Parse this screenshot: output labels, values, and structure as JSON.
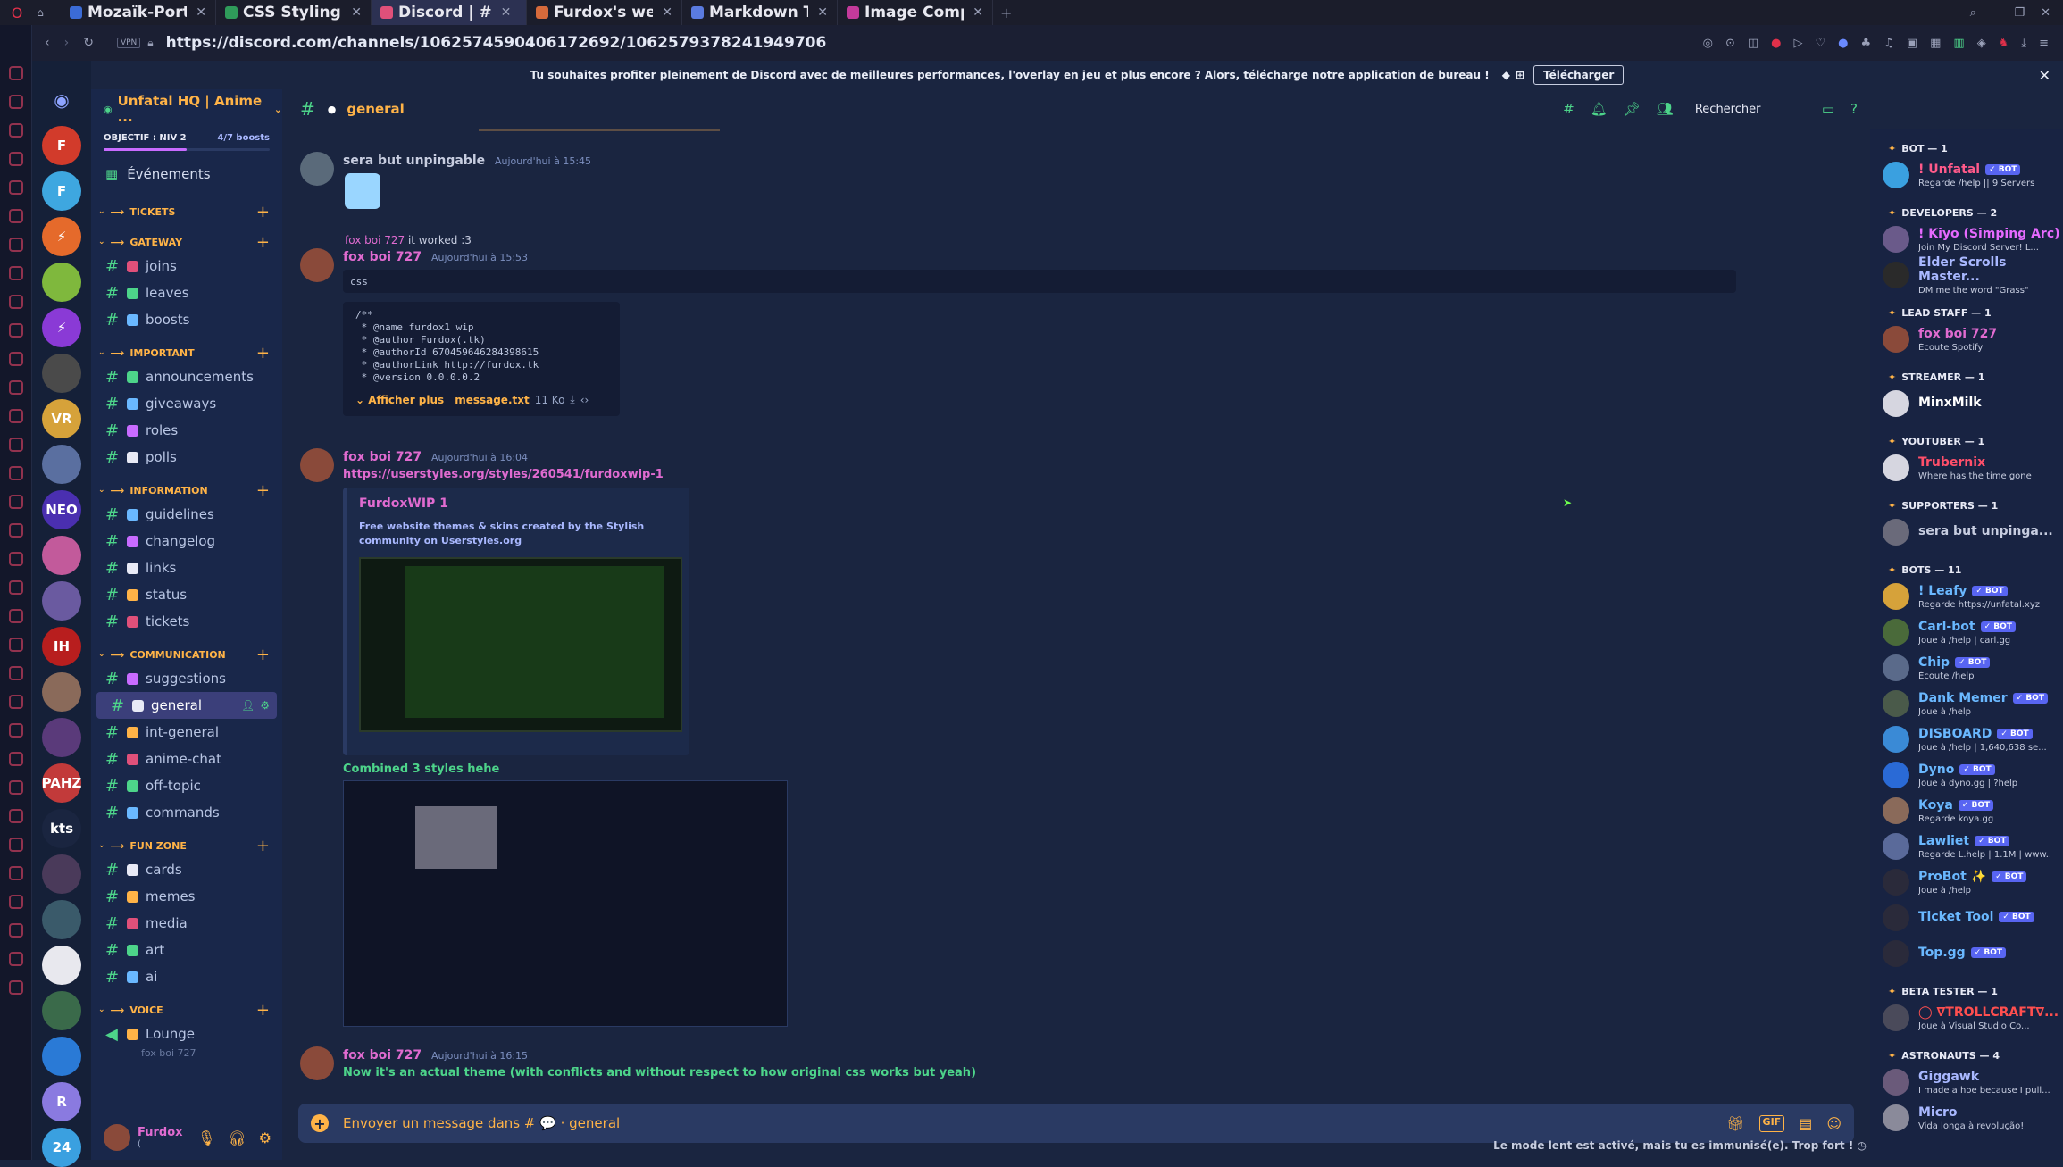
{
  "browser": {
    "tabs": [
      {
        "label": "Mozaïk-Portail",
        "color": "#3b6bd6"
      },
      {
        "label": "CSS Styling Ima",
        "color": "#2f9b5a"
      },
      {
        "label": "Discord | #",
        "color": "#e0507a"
      },
      {
        "label": "Furdox's websi",
        "color": "#d66a3b"
      },
      {
        "label": "Markdown Tex",
        "color": "#5a7be0"
      },
      {
        "label": "Image Compre",
        "color": "#c33a9b"
      }
    ],
    "url": "https://discord.com/channels/1062574590406172692/1062579378241949706"
  },
  "banner": {
    "text": "Tu souhaites profiter pleinement de Discord avec de meilleures performances, l'overlay en jeu et plus encore ? Alors, télécharge notre application de bureau !",
    "button": "Télécharger"
  },
  "server": {
    "name": "Unfatal HQ | Anime ...",
    "goal": "OBJECTIF : NIV 2",
    "boosts": "4/7 boosts",
    "events": "Événements"
  },
  "server_icons": [
    {
      "label": "F",
      "color": "#d23b2b"
    },
    {
      "label": "F",
      "color": "#3ea7e0"
    },
    {
      "label": "⚡",
      "color": "#e56a2b"
    },
    {
      "label": "",
      "color": "#7fb83d"
    },
    {
      "label": "⚡",
      "color": "#8a3ad6"
    },
    {
      "label": "",
      "color": "#4a4a4a"
    },
    {
      "label": "VR",
      "color": "#d6a23a"
    },
    {
      "label": "",
      "color": "#5a6fa0"
    },
    {
      "label": "NEO",
      "color": "#4a2fb0"
    },
    {
      "label": "",
      "color": "#c25a9b"
    },
    {
      "label": "",
      "color": "#6a5aa0"
    },
    {
      "label": "IH",
      "color": "#b81e1e"
    },
    {
      "label": "",
      "color": "#8a6a5a"
    },
    {
      "label": "",
      "color": "#5a3a7a"
    },
    {
      "label": "PAHZ",
      "color": "#c23a3a"
    },
    {
      "label": "kts",
      "color": "#1a2540"
    },
    {
      "label": "",
      "color": "#4a3a5a"
    },
    {
      "label": "",
      "color": "#3a5a6a"
    },
    {
      "label": "",
      "color": "#e8e8ee"
    },
    {
      "label": "",
      "color": "#3a6a4a"
    },
    {
      "label": "",
      "color": "#2a7ad6"
    },
    {
      "label": "R",
      "color": "#8a7ae0"
    },
    {
      "label": "24",
      "color": "#3aa0e0"
    }
  ],
  "categories": [
    {
      "name": "TICKETS",
      "channels": []
    },
    {
      "name": "GATEWAY",
      "channels": [
        "joins",
        "leaves",
        "boosts"
      ]
    },
    {
      "name": "IMPORTANT",
      "channels": [
        "announcements",
        "giveaways",
        "roles",
        "polls"
      ]
    },
    {
      "name": "INFORMATION",
      "channels": [
        "guidelines",
        "changelog",
        "links",
        "status",
        "tickets"
      ]
    },
    {
      "name": "COMMUNICATION",
      "channels": [
        "suggestions",
        "general",
        "int-general",
        "anime-chat",
        "off-topic",
        "commands"
      ]
    },
    {
      "name": "FUN ZONE",
      "channels": [
        "cards",
        "memes",
        "media",
        "art",
        "ai"
      ]
    },
    {
      "name": "VOICE",
      "channels": [
        "Lounge"
      ]
    }
  ],
  "voice_user": "fox boi 727",
  "user": {
    "name": "Furdox",
    "status": "("
  },
  "chat": {
    "channel": "general",
    "search_placeholder": "Rechercher",
    "messages": [
      {
        "author": "sera but unpingable",
        "time": "Aujourd'hui à 15:45"
      },
      {
        "reply": "fox boi 727",
        "reply_text": "it worked :3",
        "author": "fox boi 727",
        "time": "Aujourd'hui à 15:53",
        "code_lang": "css",
        "code": [
          "/**",
          " * @name furdox1 wip",
          " * @author Furdox(.tk)",
          " * @authorId 670459646284398615",
          " * @authorLink http://furdox.tk",
          " * @version 0.0.0.0.2"
        ],
        "show_more": "Afficher plus",
        "file": "message.txt",
        "size": "11 Ko"
      },
      {
        "author": "fox boi 727",
        "time": "Aujourd'hui à 16:04",
        "link": "https://userstyles.org/styles/260541/furdoxwip-1",
        "embed_title": "FurdoxWIP 1",
        "embed_desc": "Free website themes & skins created by the Stylish community on Userstyles.org",
        "caption": "Combined 3 styles hehe"
      },
      {
        "author": "fox boi 727",
        "time": "Aujourd'hui à 16:15",
        "text": "Now it's an actual theme (with conflicts and without respect to how original css works but yeah)"
      }
    ],
    "composer_placeholder": "Envoyer un message dans # 💬 · general",
    "slowmode": "Le mode lent est activé, mais tu es immunisé(e). Trop fort !"
  },
  "members": [
    {
      "role": "BOT — 1",
      "people": [
        {
          "name": "! Unfatal",
          "bot": true,
          "sub": "Regarde /help || 9 Servers",
          "color": "#ff5a8a",
          "av": "#3aa0e0"
        }
      ]
    },
    {
      "role": "DEVELOPERS — 2",
      "people": [
        {
          "name": "! Kiyo (Simping Arc)",
          "bot": false,
          "sub": "Join My Discord Server! L...",
          "color": "#e66aff",
          "av": "#6a5a8a"
        },
        {
          "name": "Elder Scrolls Master...",
          "bot": false,
          "sub": "DM me the word \"Grass\"",
          "color": "#a9b8ff",
          "av": "#2a2a2a"
        }
      ]
    },
    {
      "role": "LEAD STAFF — 1",
      "people": [
        {
          "name": "fox boi 727",
          "bot": false,
          "sub": "Écoute Spotify",
          "color": "#e06bd0",
          "av": "#8a4a3a"
        }
      ]
    },
    {
      "role": "STREAMER — 1",
      "people": [
        {
          "name": "MinxMilk",
          "bot": false,
          "sub": "",
          "color": "#ffffff",
          "av": "#d6d6e0"
        }
      ]
    },
    {
      "role": "YOUTUBER — 1",
      "people": [
        {
          "name": "Trubernix",
          "bot": false,
          "sub": "Where has the time gone",
          "color": "#ff4f6a",
          "av": "#d6d6e0"
        }
      ]
    },
    {
      "role": "SUPPORTERS — 1",
      "people": [
        {
          "name": "sera but unpinga...",
          "bot": false,
          "sub": "",
          "color": "#c7cde0",
          "av": "#6a6a7a"
        }
      ]
    },
    {
      "role": "BOTS — 11",
      "people": [
        {
          "name": "! Leafy",
          "bot": true,
          "sub": "Regarde https://unfatal.xyz",
          "color": "#6ab8ff",
          "av": "#d6a23a"
        },
        {
          "name": "Carl-bot",
          "bot": true,
          "sub": "Joue à /help | carl.gg",
          "color": "#6ab8ff",
          "av": "#4a6a3a"
        },
        {
          "name": "Chip",
          "bot": true,
          "sub": "Écoute /help",
          "color": "#6ab8ff",
          "av": "#5a6a8a"
        },
        {
          "name": "Dank Memer",
          "bot": true,
          "sub": "Joue à /help",
          "color": "#6ab8ff",
          "av": "#4a5a4a"
        },
        {
          "name": "DISBOARD",
          "bot": true,
          "sub": "Joue à /help | 1,640,638 se...",
          "color": "#6ab8ff",
          "av": "#3a8ad6"
        },
        {
          "name": "Dyno",
          "bot": true,
          "sub": "Joue à dyno.gg | ?help",
          "color": "#6ab8ff",
          "av": "#2a6ad6"
        },
        {
          "name": "Koya",
          "bot": true,
          "sub": "Regarde koya.gg",
          "color": "#6ab8ff",
          "av": "#8a6a5a"
        },
        {
          "name": "Lawliet",
          "bot": true,
          "sub": "Regarde L.help | 1.1M | www...",
          "color": "#6ab8ff",
          "av": "#5a6a9a"
        },
        {
          "name": "ProBot ✨",
          "bot": true,
          "sub": "Joue à /help",
          "color": "#6ab8ff",
          "av": "#2a2a3a"
        },
        {
          "name": "Ticket Tool",
          "bot": true,
          "sub": "",
          "color": "#6ab8ff",
          "av": "#2a2a3a"
        },
        {
          "name": "Top.gg",
          "bot": true,
          "sub": "",
          "color": "#6ab8ff",
          "av": "#2a2a3a"
        }
      ]
    },
    {
      "role": "BETA TESTER — 1",
      "people": [
        {
          "name": "◯ ∇TROLLCRAFT∇...",
          "bot": false,
          "sub": "Joue à Visual Studio Co...",
          "color": "#ff4f4f",
          "av": "#4a4a5a"
        }
      ]
    },
    {
      "role": "ASTRONAUTS — 4",
      "people": [
        {
          "name": "Giggawk",
          "bot": false,
          "sub": "I made a hoe because I pull...",
          "color": "#a9b8ff",
          "av": "#6a5a7a"
        },
        {
          "name": "Micro",
          "bot": false,
          "sub": "Vida longa à revolução!",
          "color": "#a9b8ff",
          "av": "#8a8a9a"
        }
      ]
    }
  ]
}
